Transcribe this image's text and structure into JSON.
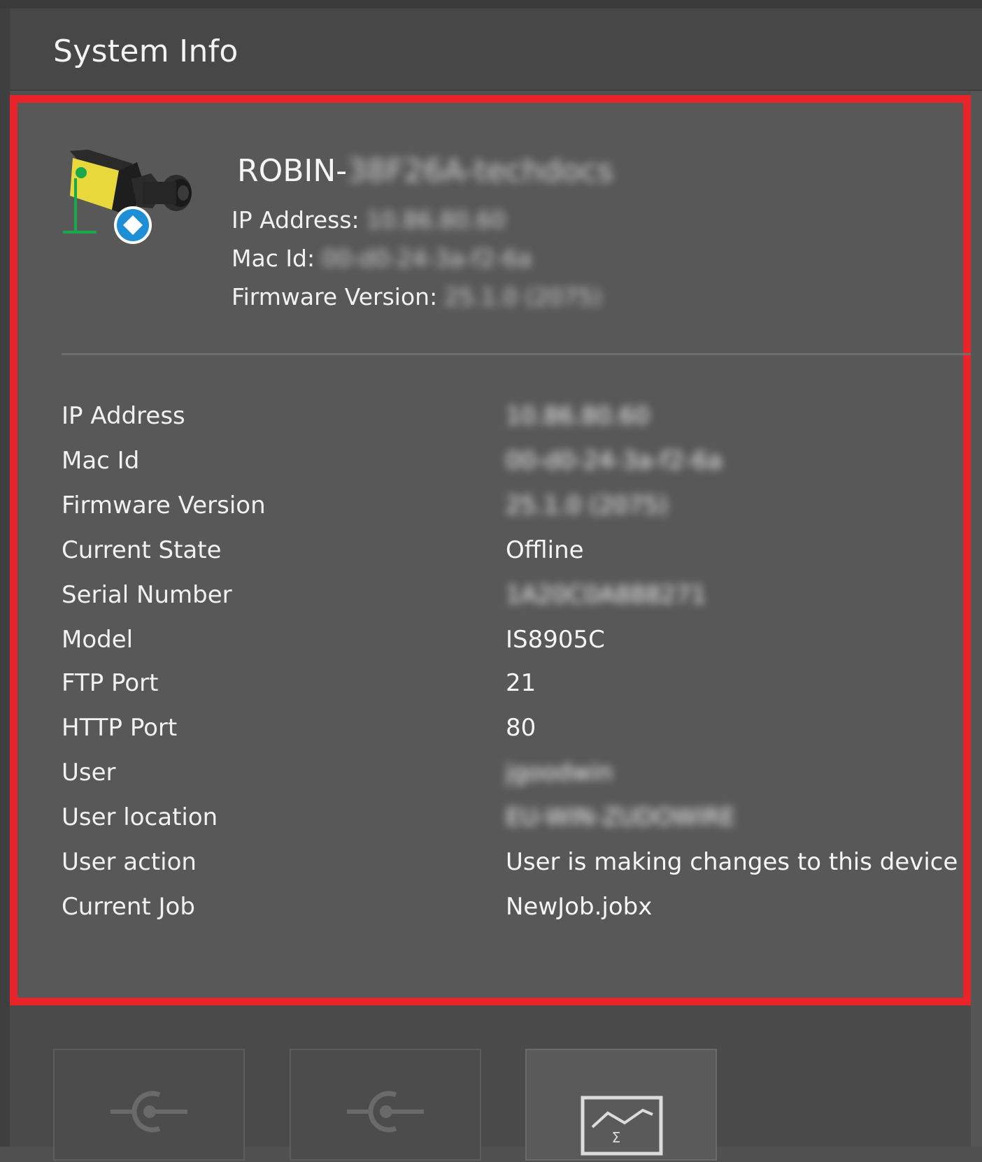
{
  "header": {
    "title": "System Info"
  },
  "device": {
    "name_prefix": "ROBIN-",
    "name_suffix": "38F26A-techdocs",
    "summary": [
      {
        "label": "IP Address:",
        "value": "10.86.80.60"
      },
      {
        "label": "Mac Id:",
        "value": "00-d0-24-3a-f2-6a"
      },
      {
        "label": "Firmware Version:",
        "value": "25.1.0 (2075)"
      }
    ]
  },
  "details": [
    {
      "label": "IP Address",
      "value": "10.86.80.60",
      "blurred": true
    },
    {
      "label": "Mac Id",
      "value": "00-d0-24-3a-f2-6a",
      "blurred": true
    },
    {
      "label": "Firmware Version",
      "value": "25.1.0 (2075)",
      "blurred": true
    },
    {
      "label": "Current State",
      "value": "Offline",
      "blurred": false
    },
    {
      "label": "Serial Number",
      "value": "1A20C0A888271",
      "blurred": true
    },
    {
      "label": "Model",
      "value": "IS8905C",
      "blurred": false
    },
    {
      "label": "FTP Port",
      "value": "21",
      "blurred": false
    },
    {
      "label": "HTTP Port",
      "value": "80",
      "blurred": false
    },
    {
      "label": "User",
      "value": "jgoodwin",
      "blurred": true
    },
    {
      "label": "User location",
      "value": "EU-WIN-ZUDOWIRE",
      "blurred": true
    },
    {
      "label": "User action",
      "value": "User is making changes to this device",
      "blurred": false
    },
    {
      "label": "Current Job",
      "value": "NewJob.jobx",
      "blurred": false
    }
  ],
  "colors": {
    "highlight_border": "#e8242a",
    "panel_bg": "#585858",
    "header_bg": "#474747"
  },
  "bottom_tiles": [
    {
      "icon": "connect-icon"
    },
    {
      "icon": "connect-icon"
    },
    {
      "icon": "spreadsheet-chart-icon"
    }
  ]
}
